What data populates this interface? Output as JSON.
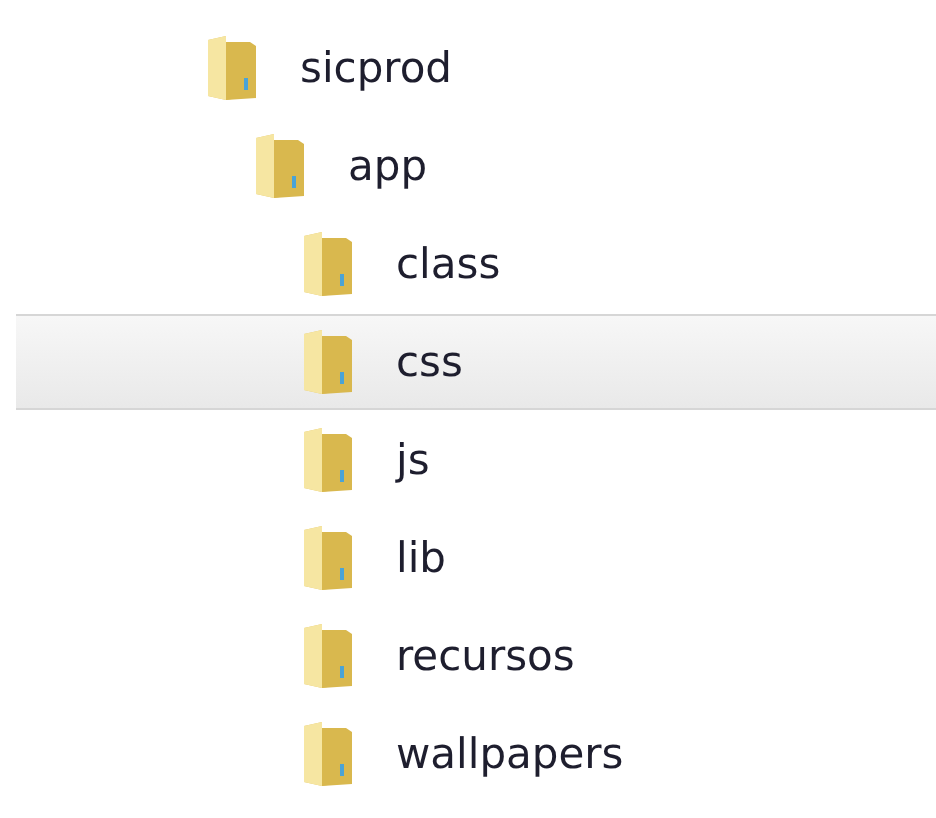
{
  "tree": [
    {
      "label": "sicprod",
      "selected": false,
      "children": [
        {
          "label": "app",
          "selected": false,
          "children": [
            {
              "label": "class",
              "selected": false
            },
            {
              "label": "css",
              "selected": true
            },
            {
              "label": "js",
              "selected": false
            },
            {
              "label": "lib",
              "selected": false
            },
            {
              "label": "recursos",
              "selected": false
            },
            {
              "label": "wallpapers",
              "selected": false
            }
          ]
        }
      ]
    }
  ]
}
